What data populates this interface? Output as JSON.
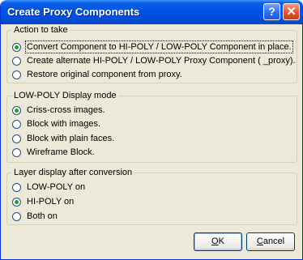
{
  "window": {
    "title": "Create Proxy Components",
    "help_label": "?",
    "close_label": "✕"
  },
  "action_group": {
    "title": "Action to take",
    "options": [
      {
        "label": "Convert Component to HI-POLY / LOW-POLY Component in place.",
        "checked": true
      },
      {
        "label": "Create alternate HI-POLY / LOW-POLY Proxy Component ( _proxy).",
        "checked": false
      },
      {
        "label": "Restore original component from proxy.",
        "checked": false
      }
    ]
  },
  "display_group": {
    "title": "LOW-POLY Display mode",
    "options": [
      {
        "label": "Criss-cross images.",
        "checked": true
      },
      {
        "label": "Block with images.",
        "checked": false
      },
      {
        "label": "Block with plain faces.",
        "checked": false
      },
      {
        "label": "Wireframe Block.",
        "checked": false
      }
    ]
  },
  "layer_group": {
    "title": "Layer display after conversion",
    "options": [
      {
        "label": "LOW-POLY on",
        "checked": false
      },
      {
        "label": "HI-POLY on",
        "checked": true
      },
      {
        "label": "Both on",
        "checked": false
      }
    ]
  },
  "buttons": {
    "ok_mnemonic": "O",
    "ok_rest": "K",
    "cancel_mnemonic": "C",
    "cancel_rest": "ancel"
  }
}
